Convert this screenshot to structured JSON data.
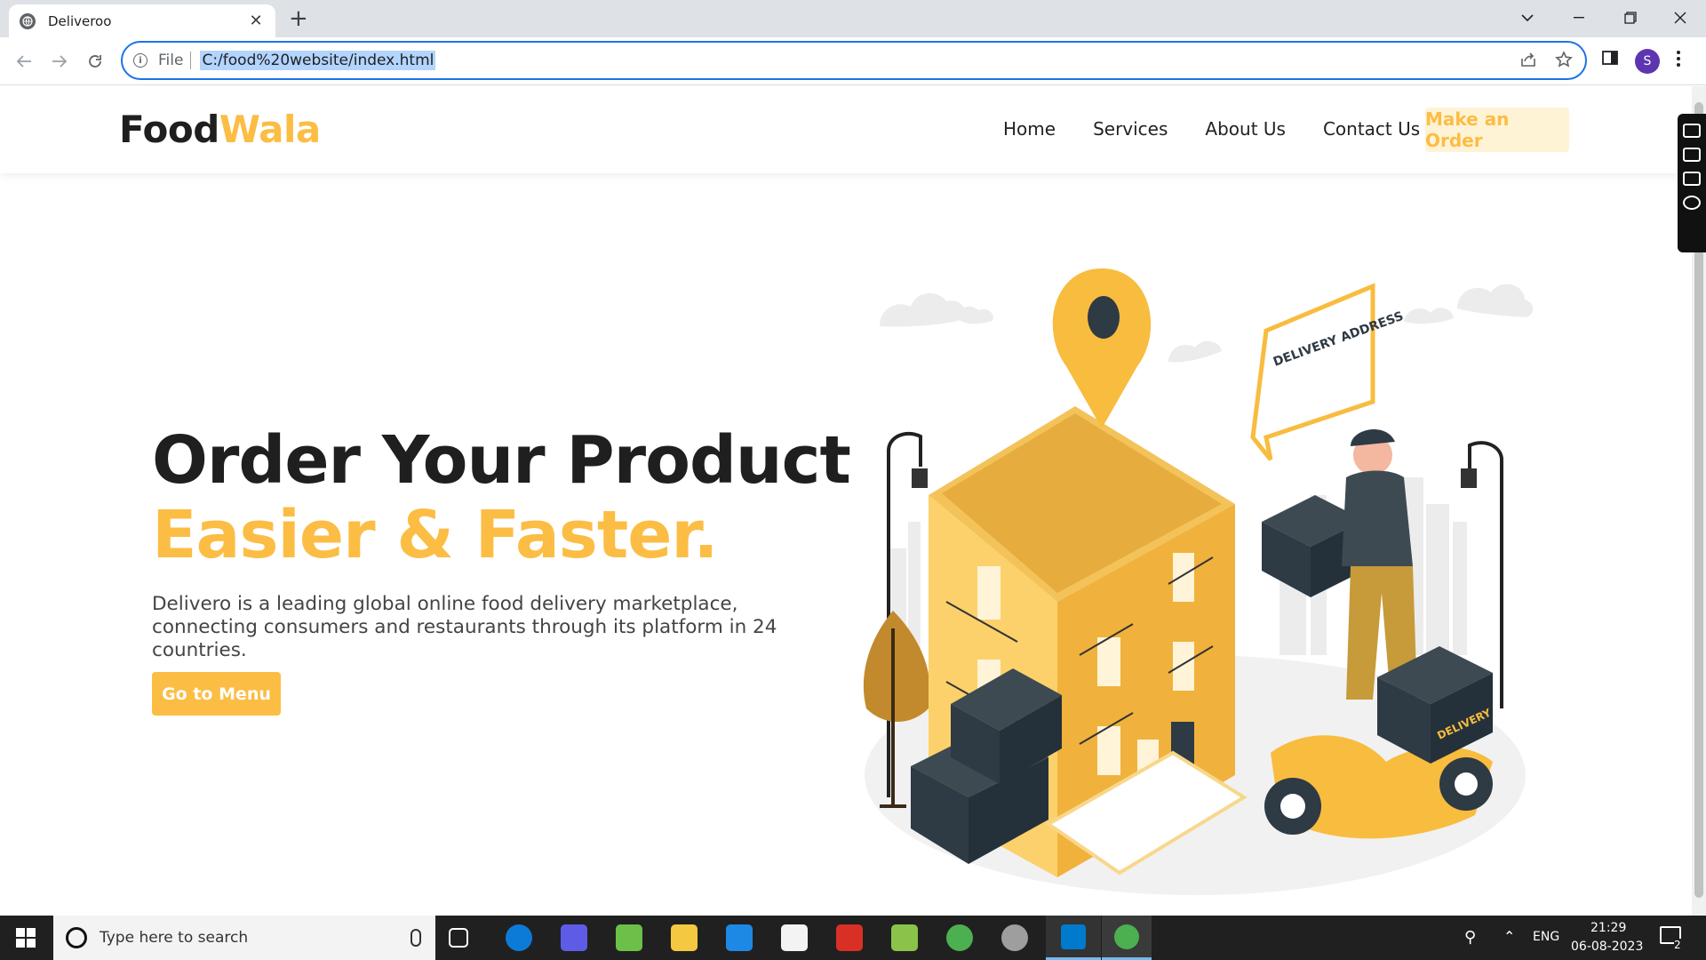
{
  "browser": {
    "tab_title": "Deliveroo",
    "url_prefix": "File",
    "url": "C:/food%20website/index.html",
    "profile_initial": "S"
  },
  "site": {
    "logo_part1": "Food",
    "logo_part2": "Wala",
    "nav": [
      "Home",
      "Services",
      "About Us",
      "Contact Us"
    ],
    "order_button": "Make an Order",
    "hero_title_line1": "Order Your Product",
    "hero_title_line2": "Easier & Faster.",
    "hero_description": "Delivero is a leading global online food delivery marketplace, connecting consumers and restaurants through its platform in 24 countries.",
    "menu_button": "Go to Menu",
    "illustration_sign": "DELIVERY ADDRESS",
    "illustration_box_label": "DELIVERY"
  },
  "taskbar": {
    "search_placeholder": "Type here to search",
    "language": "ENG",
    "time": "21:29",
    "date": "06-08-2023",
    "notification_count": "2"
  },
  "colors": {
    "accent": "#fcbd44",
    "dark_text": "#1f1f1f",
    "order_button_bg": "#fff3d6",
    "omnibox_border": "#1a73e8"
  }
}
